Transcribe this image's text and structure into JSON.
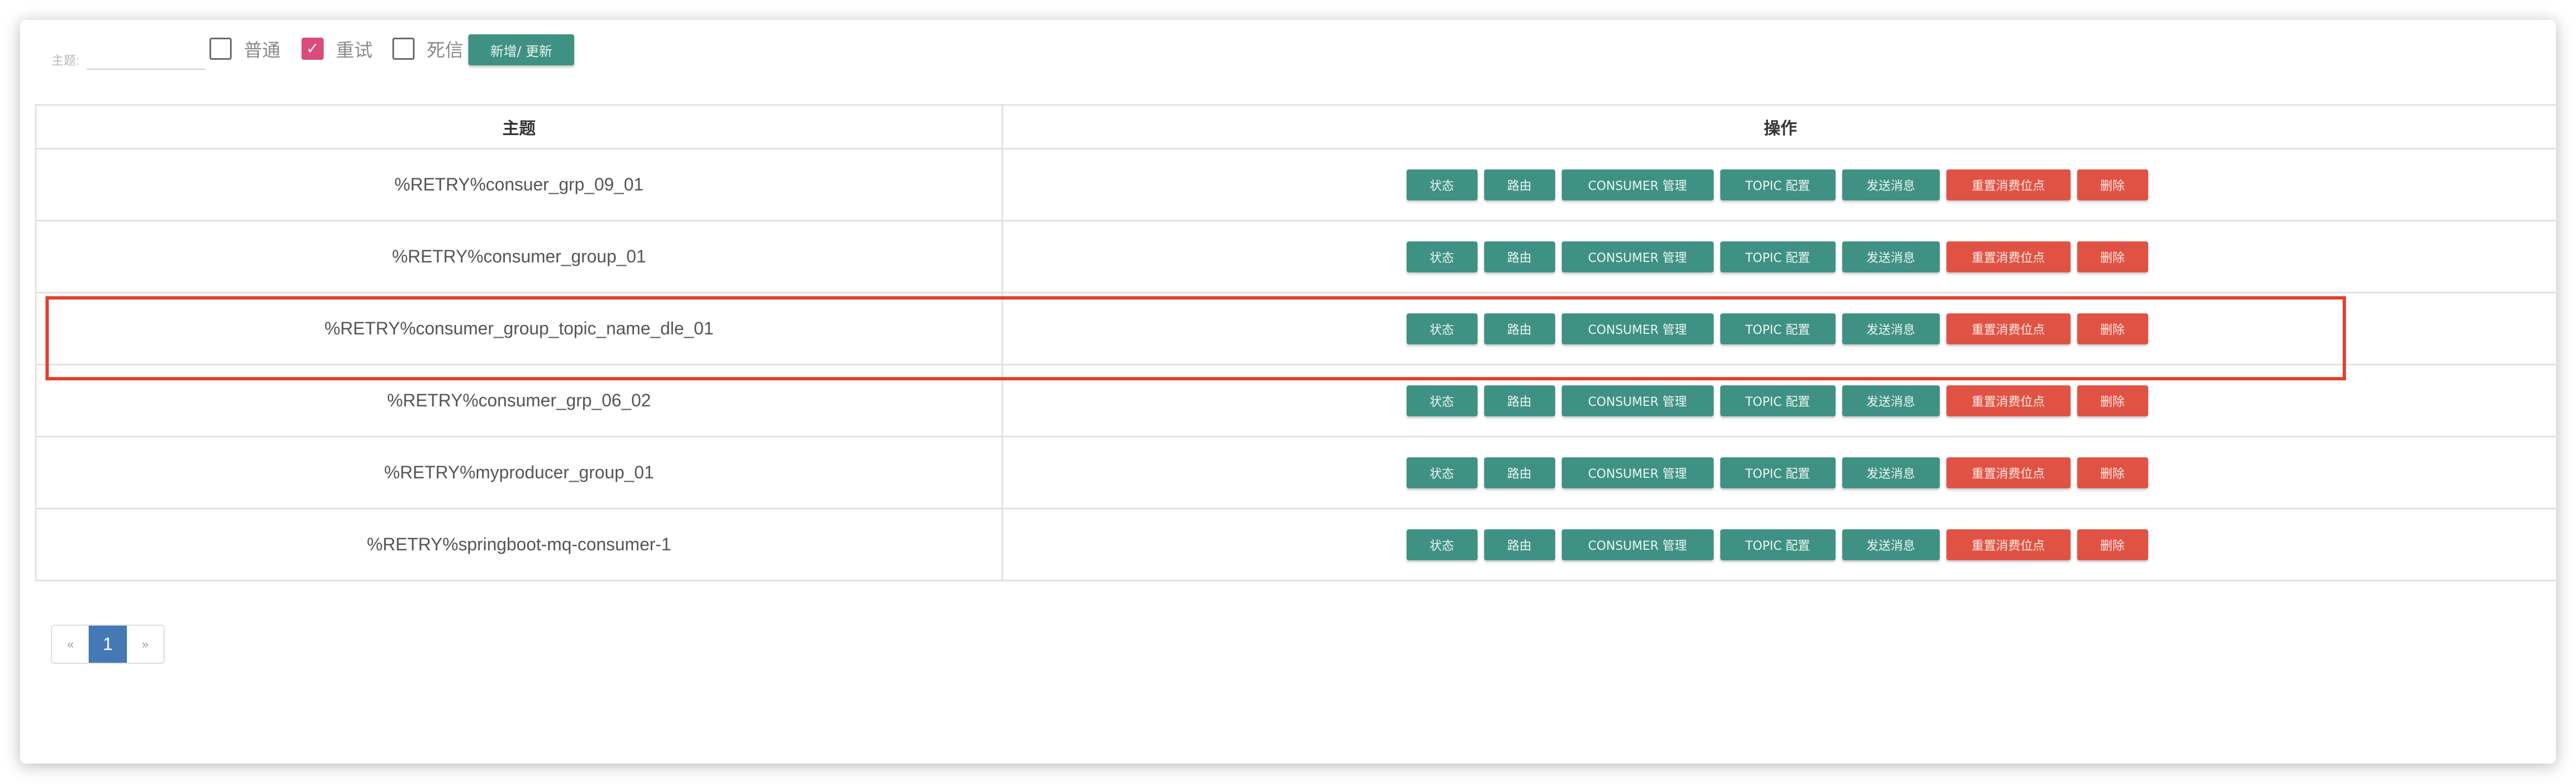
{
  "filter": {
    "topic_label": "主题:",
    "topic_value": "",
    "topic_placeholder": "",
    "checkboxes": [
      {
        "label": "普通",
        "checked": false
      },
      {
        "label": "重试",
        "checked": true
      },
      {
        "label": "死信",
        "checked": false
      }
    ],
    "add_update_label": "新增/ 更新",
    "colors": {
      "checked": "#d94b79",
      "primary": "#3f9283"
    }
  },
  "table": {
    "headers": [
      "主题",
      "操作"
    ],
    "rows": [
      {
        "topic": "%RETRY%consuer_grp_09_01"
      },
      {
        "topic": "%RETRY%consumer_group_01"
      },
      {
        "topic": "%RETRY%consumer_group_topic_name_dle_01",
        "highlighted": true
      },
      {
        "topic": "%RETRY%consumer_grp_06_02"
      },
      {
        "topic": "%RETRY%myproducer_group_01"
      },
      {
        "topic": "%RETRY%springboot-mq-consumer-1"
      }
    ],
    "actions": {
      "status": "状态",
      "route": "路由",
      "consumer": "CONSUMER 管理",
      "topic_config": "TOPIC 配置",
      "send": "发送消息",
      "reset_offset": "重置消费位点",
      "delete": "删除"
    },
    "colors": {
      "action": "#3f9283",
      "danger": "#e05344"
    }
  },
  "pagination": {
    "prev": "«",
    "current": "1",
    "next": "»",
    "color": "#4479b5"
  },
  "annotation": {
    "color": "#e8402a"
  }
}
